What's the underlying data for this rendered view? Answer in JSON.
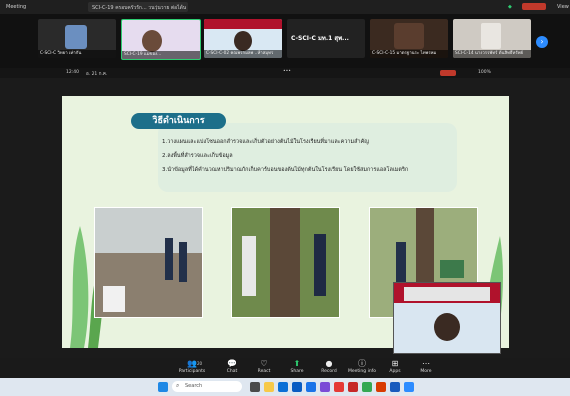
{
  "window": {
    "title": "Meeting",
    "tab_title": "SCI-C-19 ครอบครัวรัก... วนวุ่นวาย ต่อได้นะ",
    "right_title": "View"
  },
  "filmstrip": [
    {
      "label": "C-SCI-C วิทยา เท่ากัน"
    },
    {
      "label": "SCI-C-19 แม่ของ..."
    },
    {
      "label": "C-SCI-C-02 คณพรกมลพ ..ห้าสมุทร"
    },
    {
      "label": "C-SCI-C มท.1 สุพ..."
    },
    {
      "label": "C-SCI-C-15 มาตรฐานระ ไทพรหม"
    },
    {
      "label": "SCI-C-16 นายสุภาณ ศึกพพ"
    },
    {
      "label": "SCI-C-14 นางวรรพัทร์ ต้นสิทธิ์ทรัพย์"
    }
  ],
  "share_bar": {
    "time": "12:40",
    "date": "อ. 21 ก.ค.",
    "status": "100%"
  },
  "slide": {
    "title": "วิธีดำเนินการ",
    "steps": [
      "1.วางแผนและแบ่งโซนออกสำรวจและเก็บตัวอย่างต้นไม้ในโรงเรียนที่มาและความสำคัญ",
      "2.ลงพื้นที่สำรวจและเก็บข้อมูล",
      "3.นำข้อมูลที่ได้คำนวณหาปริมาณกักเก็บคาร์บอนของต้นไม้ทุกต้นในโรงเรียน โดยใช้สมการแอลโลเมตริก"
    ]
  },
  "toolbar": [
    {
      "label": "Participants",
      "icon": "people-icon",
      "glyph": "👥"
    },
    {
      "label": "Chat",
      "icon": "chat-icon",
      "glyph": "💬"
    },
    {
      "label": "React",
      "icon": "heart-icon",
      "glyph": "♡"
    },
    {
      "label": "Share",
      "icon": "share-icon",
      "glyph": "⬆"
    },
    {
      "label": "Record",
      "icon": "record-icon",
      "glyph": "●"
    },
    {
      "label": "Meeting info",
      "icon": "info-icon",
      "glyph": "ⓘ"
    },
    {
      "label": "Apps",
      "icon": "apps-icon",
      "glyph": "⊞"
    },
    {
      "label": "More",
      "icon": "more-icon",
      "glyph": "⋯"
    }
  ],
  "participants_count": "20",
  "taskbar": {
    "search_placeholder": "Search"
  }
}
